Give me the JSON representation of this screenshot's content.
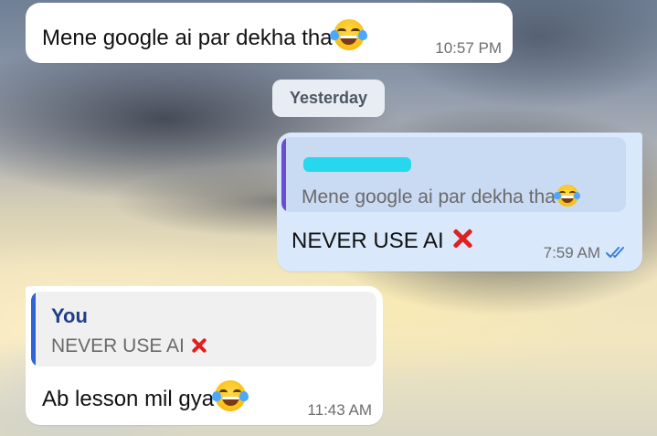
{
  "date_separator": "Yesterday",
  "messages": [
    {
      "direction": "incoming",
      "text": "Mene google ai par dekha tha",
      "emoji": "face-with-tears-of-joy",
      "time": "10:57 PM"
    },
    {
      "direction": "outgoing",
      "reply_to": {
        "sender": "",
        "sender_redacted": true,
        "text": "Mene google ai par dekha tha",
        "emoji": "face-with-tears-of-joy"
      },
      "text": "NEVER USE AI",
      "emoji": "cross-mark",
      "time": "7:59 AM",
      "status": "read"
    },
    {
      "direction": "incoming",
      "reply_to": {
        "sender": "You",
        "text": "NEVER USE AI",
        "emoji": "cross-mark"
      },
      "text": "Ab lesson mil gya",
      "emoji": "face-with-tears-of-joy",
      "time": "11:43 AM"
    }
  ],
  "colors": {
    "incoming_bubble": "#ffffff",
    "outgoing_bubble": "#d9e8fb",
    "reply_bar_outgoing": "#6c4bd6",
    "reply_bar_incoming": "#2f63d8",
    "reply_sender_you": "#1f3f86",
    "read_ticks": "#3b7de0",
    "redaction": "#27d7ee"
  }
}
